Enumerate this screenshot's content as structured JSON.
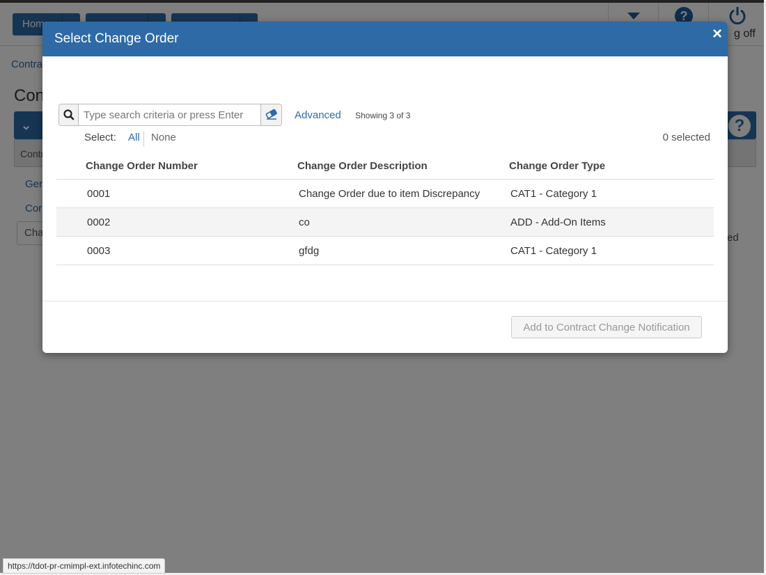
{
  "nav": {
    "home_label": "Hom",
    "logoff_label": "g off"
  },
  "background": {
    "breadcrumb": "Contra",
    "title": "Con",
    "panel_sub": "Contr",
    "link_gen": "Ger",
    "link_con": "Cor",
    "box_label": "Cha",
    "side_text": "ed"
  },
  "modal": {
    "title": "Select Change Order",
    "search_placeholder": "Type search criteria or press Enter",
    "advanced_label": "Advanced",
    "showing_text": "Showing 3 of 3",
    "select_label": "Select:",
    "select_all": "All",
    "select_none": "None",
    "selected_count": "0 selected",
    "columns": [
      "Change Order Number",
      "Change Order Description",
      "Change Order Type"
    ],
    "rows": [
      {
        "number": "0001",
        "description": "Change Order due to item Discrepancy",
        "type": "CAT1 - Category 1"
      },
      {
        "number": "0002",
        "description": "co",
        "type": "ADD - Add-On Items"
      },
      {
        "number": "0003",
        "description": "gfdg",
        "type": "CAT1 - Category 1"
      }
    ],
    "add_button": "Add to Contract Change Notification"
  },
  "status_bar": "https://tdot-pr-cmimpl-ext.infotechinc.com",
  "colors": {
    "primary": "#2d6aa6",
    "overlay": "rgba(0,0,0,0.5)"
  }
}
